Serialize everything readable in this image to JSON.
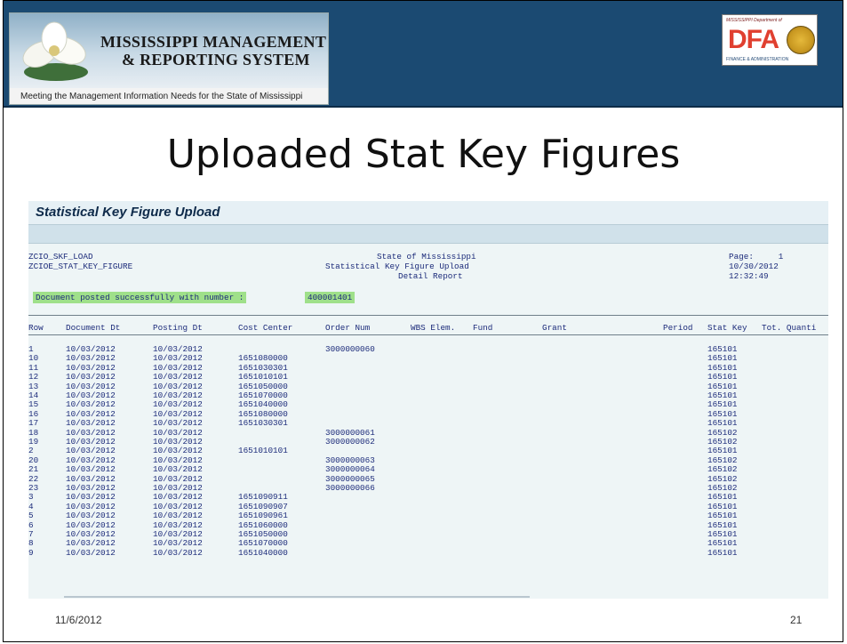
{
  "header": {
    "logo_line1": "MISSISSIPPI MANAGEMENT",
    "logo_line2": "& REPORTING SYSTEM",
    "tagline": "Meeting the Management Information Needs for the State of Mississippi",
    "dfa_top": "MISSISSIPPI Department of",
    "dfa_letters": "DFA",
    "dfa_bottom": "FINANCE & ADMINISTRATION"
  },
  "slide_title": "Uploaded Stat Key Figures",
  "sap": {
    "window_title": "Statistical Key Figure Upload",
    "report_left_1": "ZCIO_SKF_LOAD",
    "report_left_2": "ZCIOE_STAT_KEY_FIGURE",
    "report_mid_1": "State of Mississippi",
    "report_mid_2": "Statistical Key Figure Upload",
    "report_mid_3": "Detail Report",
    "report_right_1": "Page:     1",
    "report_right_2": "10/30/2012",
    "report_right_3": "12:32:49",
    "posted_message": "Document posted successfully with number :",
    "posted_number": "400001401",
    "columns": [
      "Row",
      "Document Dt",
      "Posting Dt",
      "Cost Center",
      "Order Num",
      "WBS Elem.",
      "Fund",
      "Grant",
      "Period",
      "Stat Key",
      "Tot. Quanti"
    ],
    "rows": [
      [
        "1",
        "10/03/2012",
        "10/03/2012",
        "",
        "3000000060",
        "165101"
      ],
      [
        "10",
        "10/03/2012",
        "10/03/2012",
        "1651080000",
        "",
        "165101"
      ],
      [
        "11",
        "10/03/2012",
        "10/03/2012",
        "1651030301",
        "",
        "165101"
      ],
      [
        "12",
        "10/03/2012",
        "10/03/2012",
        "1651010101",
        "",
        "165101"
      ],
      [
        "13",
        "10/03/2012",
        "10/03/2012",
        "1651050000",
        "",
        "165101"
      ],
      [
        "14",
        "10/03/2012",
        "10/03/2012",
        "1651070000",
        "",
        "165101"
      ],
      [
        "15",
        "10/03/2012",
        "10/03/2012",
        "1651040000",
        "",
        "165101"
      ],
      [
        "16",
        "10/03/2012",
        "10/03/2012",
        "1651080000",
        "",
        "165101"
      ],
      [
        "17",
        "10/03/2012",
        "10/03/2012",
        "1651030301",
        "",
        "165101"
      ],
      [
        "18",
        "10/03/2012",
        "10/03/2012",
        "",
        "3000000061",
        "165102"
      ],
      [
        "19",
        "10/03/2012",
        "10/03/2012",
        "",
        "3000000062",
        "165102"
      ],
      [
        "2",
        "10/03/2012",
        "10/03/2012",
        "1651010101",
        "",
        "165101"
      ],
      [
        "20",
        "10/03/2012",
        "10/03/2012",
        "",
        "3000000063",
        "165102"
      ],
      [
        "21",
        "10/03/2012",
        "10/03/2012",
        "",
        "3000000064",
        "165102"
      ],
      [
        "22",
        "10/03/2012",
        "10/03/2012",
        "",
        "3000000065",
        "165102"
      ],
      [
        "23",
        "10/03/2012",
        "10/03/2012",
        "",
        "3000000066",
        "165102"
      ],
      [
        "3",
        "10/03/2012",
        "10/03/2012",
        "1651090911",
        "",
        "165101"
      ],
      [
        "4",
        "10/03/2012",
        "10/03/2012",
        "1651090907",
        "",
        "165101"
      ],
      [
        "5",
        "10/03/2012",
        "10/03/2012",
        "1651090961",
        "",
        "165101"
      ],
      [
        "6",
        "10/03/2012",
        "10/03/2012",
        "1651060000",
        "",
        "165101"
      ],
      [
        "7",
        "10/03/2012",
        "10/03/2012",
        "1651050000",
        "",
        "165101"
      ],
      [
        "8",
        "10/03/2012",
        "10/03/2012",
        "1651070000",
        "",
        "165101"
      ],
      [
        "9",
        "10/03/2012",
        "10/03/2012",
        "1651040000",
        "",
        "165101"
      ]
    ]
  },
  "footer": {
    "date": "11/6/2012",
    "page_number": "21"
  }
}
